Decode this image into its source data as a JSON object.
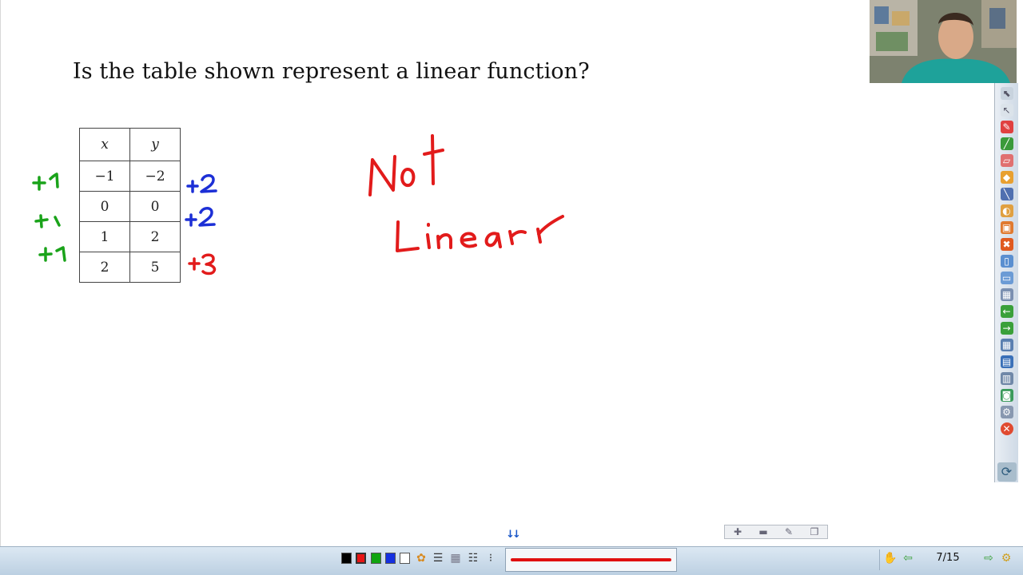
{
  "slide": {
    "question": "Is the table shown represent a linear function?",
    "table": {
      "headers": [
        "x",
        "y"
      ],
      "rows": [
        [
          "−1",
          "−2"
        ],
        [
          "0",
          "0"
        ],
        [
          "1",
          "2"
        ],
        [
          "2",
          "5"
        ]
      ]
    }
  },
  "annotations": {
    "x_diffs": [
      "+1",
      "+1",
      "+1"
    ],
    "y_diffs": [
      "+2",
      "+2",
      "+3"
    ],
    "conclusion": [
      "Not",
      "Linear"
    ],
    "colors": {
      "x_diffs": "#1aa31a",
      "y_diffs_same": "#1c2fd6",
      "y_diff_changed": "#e21b1b",
      "conclusion": "#e21b1b"
    }
  },
  "right_toolbar": {
    "icons": [
      "select-arrow-icon",
      "pointer-icon",
      "pen-icon",
      "highlighter-icon",
      "eraser-icon",
      "shape-icon",
      "line-icon",
      "fill-icon",
      "image-icon",
      "clear-icon",
      "new-page-icon",
      "copy-page-icon",
      "screenshot-icon",
      "back-icon",
      "forward-icon",
      "grid-icon",
      "save-icon",
      "print-icon",
      "capture-icon",
      "tools-icon",
      "close-icon",
      "refresh-icon"
    ]
  },
  "zoom_controls": {
    "icons": [
      "zoom-in-icon",
      "zoom-out-icon",
      "edit-icon",
      "window-icon"
    ]
  },
  "bottom_toolbar": {
    "colors": [
      "#000000",
      "#e81414",
      "#10a410",
      "#1530e0",
      "#ffffff"
    ],
    "pen_color": "#e01010",
    "page_indicator": "7/15"
  }
}
